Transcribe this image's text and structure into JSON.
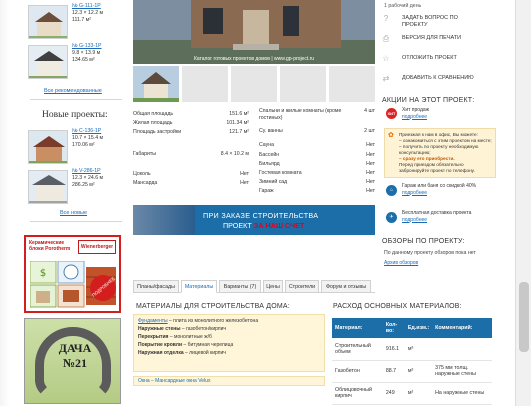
{
  "left": {
    "top_projects": [
      {
        "name": "№ G-111-1P",
        "l1": "12.3 × 12.2 м",
        "l2": "111.7 м²"
      },
      {
        "name": "№ G-133-1P",
        "l1": "9.8 × 13.9 м",
        "l2": "134.65 м²"
      }
    ],
    "all_recommended": "Все рекомендованные",
    "new_title": "Новые проекты:",
    "new_projects": [
      {
        "name": "№ C-136-1P",
        "l1": "10.7 × 15.4 м",
        "l2": "170.06 м²"
      },
      {
        "name": "№ V-286-1P",
        "l1": "12.3 × 24.6 м",
        "l2": "286.25 м²"
      }
    ],
    "all_new": "Все новые",
    "ad_porotherm": {
      "title": "Керамические блоки Porotherm",
      "brand": "Wienerberger",
      "badge": "ПОДРОБНЕЕ"
    },
    "ad_dacha": {
      "text": "ДАЧА №21"
    }
  },
  "main_image": {
    "caption": "Каталог готовых проектов домов | www.gp-project.ru"
  },
  "specs": {
    "left": [
      {
        "k": "Общая площадь",
        "v": "151.6 м²"
      },
      {
        "k": "Жилая площадь",
        "v": "101.34 м²"
      },
      {
        "k": "Площадь застройки",
        "v": "121.7 м²"
      },
      {
        "k": "Габариты",
        "v": "8.4 × 10.2 м"
      },
      {
        "k": "Цоколь",
        "v": "Нет"
      },
      {
        "k": "Мансарда",
        "v": "Нет"
      }
    ],
    "right": [
      {
        "k": "Спальни и жилые комнаты (кроме гостиных)",
        "v": "4 шт"
      },
      {
        "k": "Су. ванны",
        "v": "2 шт"
      },
      {
        "k": "Сауна",
        "v": "Нет"
      },
      {
        "k": "Бассейн",
        "v": "Нет"
      },
      {
        "k": "Бильярд",
        "v": "Нет"
      },
      {
        "k": "Гостевая комната",
        "v": "Нет"
      },
      {
        "k": "Зимний сад",
        "v": "Нет"
      },
      {
        "k": "Гараж",
        "v": "Нет"
      }
    ]
  },
  "banner": {
    "l1": "ПРИ ЗАКАЗЕ СТРОИТЕЛЬСТВА",
    "l2_pre": "ПРОЕКТ ",
    "l2_hl": "ЗА НАШ СЧЕТ"
  },
  "tabs": [
    "Планы/фасады",
    "Материалы",
    "Варианты (7)",
    "Цены",
    "Строители",
    "Форум и отзывы"
  ],
  "materials": {
    "title": "МАТЕРИАЛЫ ДЛЯ СТРОИТЕЛЬСТВА ДОМА:",
    "lines": [
      {
        "k": "Фундаменты",
        "v": " – плита из монолитного железобетона"
      },
      {
        "k": "Наружные стены",
        "v": " – газобетон/кирпич"
      },
      {
        "k": "Перекрытия",
        "v": " – монолитные ж/б"
      },
      {
        "k": "Покрытие кровли",
        "v": " – битумная черепица"
      },
      {
        "k": "Наружная отделка",
        "v": " – лицевой кирпич"
      }
    ],
    "oka": "Окна – Мансардные окна Velux"
  },
  "raskhod": {
    "title": "РАСХОД ОСНОВНЫХ МАТЕРИАЛОВ:",
    "headers": [
      "Материал:",
      "Кол-во:",
      "Ед.изм.:",
      "Комментарий:"
    ],
    "rows": [
      [
        "Строительный объем",
        "916.1",
        "м³",
        ""
      ],
      [
        "Газобетон",
        "88.7",
        "м³",
        "375 мм толщ. наружные стены"
      ],
      [
        "Облицовочный кирпич",
        "249",
        "м²",
        "На наружные стены"
      ]
    ]
  },
  "right": {
    "work_days": "1 рабочий день",
    "menu": [
      {
        "icon": "question-icon",
        "glyph": "?",
        "label": "ЗАДАТЬ ВОПРОС ПО ПРОЕКТУ"
      },
      {
        "icon": "print-icon",
        "glyph": "⎙",
        "label": "ВЕРСИЯ ДЛЯ ПЕЧАТИ"
      },
      {
        "icon": "star-icon",
        "glyph": "☆",
        "label": "ОТЛОЖИТЬ ПРОЕКТ"
      },
      {
        "icon": "compare-icon",
        "glyph": "⇄",
        "label": "ДОБАВИТЬ К СРАВНЕНИЮ"
      }
    ],
    "actions_title": "АКЦИИ НА ЭТОТ ПРОЕКТ:",
    "hit": {
      "badge": "ХИТ",
      "label": "Хит продаж",
      "link": "подробнее"
    },
    "promo_box": [
      "Приезжая к нам в офис, Вы можете:",
      "– ознакомиться с этим проектом на месте;",
      "– получить по проекту необходимую консультацию;",
      "– сразу его приобрести.",
      "Перед приездом обязательно забронируйте проект по телефону."
    ],
    "garage": {
      "label": "Гараж или баня со скидкой 40%",
      "link": "подробнее"
    },
    "delivery": {
      "label": "Бесплатная доставка проекта",
      "link": "подробнее"
    },
    "reviews_title": "ОБЗОРЫ ПО ПРОЕКТУ:",
    "reviews_text": "По данному проекту обзоров пока нет",
    "reviews_link": "Архив обзоров"
  }
}
